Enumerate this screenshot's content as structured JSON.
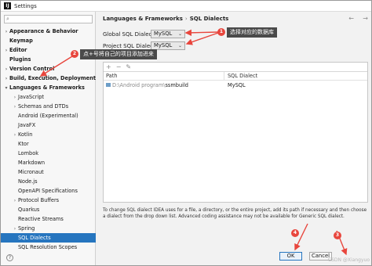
{
  "window": {
    "title": "Settings"
  },
  "sidebar": {
    "search_placeholder": "",
    "items": [
      {
        "label": "Appearance & Behavior",
        "level": 0,
        "expand": "closed"
      },
      {
        "label": "Keymap",
        "level": 0,
        "expand": "none"
      },
      {
        "label": "Editor",
        "level": 0,
        "expand": "closed"
      },
      {
        "label": "Plugins",
        "level": 0,
        "expand": "none"
      },
      {
        "label": "Version Control",
        "level": 0,
        "expand": "closed"
      },
      {
        "label": "Build, Execution, Deployment",
        "level": 0,
        "expand": "closed"
      },
      {
        "label": "Languages & Frameworks",
        "level": 0,
        "expand": "open"
      },
      {
        "label": "JavaScript",
        "level": 1,
        "expand": "closed"
      },
      {
        "label": "Schemas and DTDs",
        "level": 1,
        "expand": "closed"
      },
      {
        "label": "Android (Experimental)",
        "level": 1,
        "expand": "none"
      },
      {
        "label": "JavaFX",
        "level": 1,
        "expand": "none"
      },
      {
        "label": "Kotlin",
        "level": 1,
        "expand": "closed"
      },
      {
        "label": "Ktor",
        "level": 1,
        "expand": "none"
      },
      {
        "label": "Lombok",
        "level": 1,
        "expand": "none"
      },
      {
        "label": "Markdown",
        "level": 1,
        "expand": "none"
      },
      {
        "label": "Micronaut",
        "level": 1,
        "expand": "none"
      },
      {
        "label": "Node.js",
        "level": 1,
        "expand": "none"
      },
      {
        "label": "OpenAPI Specifications",
        "level": 1,
        "expand": "none"
      },
      {
        "label": "Protocol Buffers",
        "level": 1,
        "expand": "closed"
      },
      {
        "label": "Quarkus",
        "level": 1,
        "expand": "none"
      },
      {
        "label": "Reactive Streams",
        "level": 1,
        "expand": "none"
      },
      {
        "label": "Spring",
        "level": 1,
        "expand": "closed"
      },
      {
        "label": "SQL Dialects",
        "level": 1,
        "expand": "none",
        "selected": true
      },
      {
        "label": "SQL Resolution Scopes",
        "level": 1,
        "expand": "none"
      }
    ]
  },
  "breadcrumb": {
    "parent": "Languages & Frameworks",
    "separator": "›",
    "current": "SQL Dialects"
  },
  "fields": {
    "global_label": "Global SQL Dialect:",
    "global_value": "MySQL",
    "project_label": "Project SQL Dialect:",
    "project_value": "MySQL"
  },
  "table": {
    "toolbar": [
      "+",
      "−",
      "✎"
    ],
    "headers": {
      "path": "Path",
      "dialect": "SQL Dialect"
    },
    "rows": [
      {
        "path_prefix": "D:\\Android program\\",
        "path_name": "ssmbuild",
        "dialect": "MySQL"
      }
    ]
  },
  "help_text": "To change SQL dialect IDEA uses for a file, a directory, or the entire project, add its path if necessary and then choose a dialect from the drop down list. Advanced coding assistance may not be available for Generic SQL dialect.",
  "buttons": {
    "ok": "OK",
    "cancel": "Cancel"
  },
  "callouts": {
    "one_badge": "1",
    "one_text": "选择对应的数据库",
    "two_badge": "2",
    "two_text": "点+号将自己的项目添加进来",
    "three_badge": "3",
    "four_badge": "4"
  },
  "watermark": "CSDN @Xiangyuo",
  "colors": {
    "selection": "#2675bf",
    "callout_bg": "#4a4a4a",
    "badge": "#e8463d",
    "arrow": "#e8463d"
  },
  "icons": [
    "search-icon",
    "chevron-right-icon",
    "chevron-down-icon",
    "folder-icon",
    "add-icon",
    "remove-icon",
    "edit-icon",
    "help-icon",
    "back-icon",
    "forward-icon"
  ]
}
